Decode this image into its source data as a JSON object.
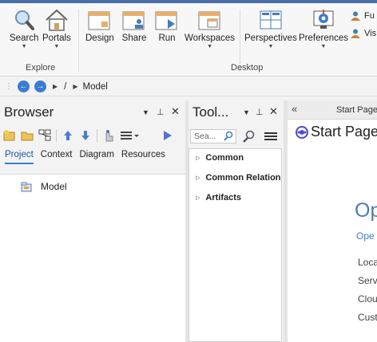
{
  "ribbon": {
    "explore": {
      "label": "Explore",
      "buttons": [
        {
          "name": "search",
          "label": "Search",
          "icon": "magnifier-icon"
        },
        {
          "name": "portals",
          "label": "Portals",
          "icon": "home-icon"
        }
      ]
    },
    "desktop": {
      "label": "Desktop",
      "buttons": [
        {
          "name": "design",
          "label": "Design",
          "icon": "design-window-icon"
        },
        {
          "name": "share",
          "label": "Share",
          "icon": "share-window-icon"
        },
        {
          "name": "run",
          "label": "Run",
          "icon": "run-window-icon"
        },
        {
          "name": "workspaces",
          "label": "Workspaces",
          "icon": "workspace-icon"
        },
        {
          "name": "perspectives",
          "label": "Perspectives",
          "icon": "perspectives-icon"
        },
        {
          "name": "preferences",
          "label": "Preferences",
          "icon": "preferences-icon"
        }
      ]
    },
    "side": [
      {
        "label": "Fu",
        "icon": "user-icon"
      },
      {
        "label": "Vis",
        "icon": "user-icon"
      }
    ]
  },
  "nav": {
    "back": "←",
    "forward": "→",
    "root": "/",
    "current": "Model"
  },
  "browser": {
    "title": "Browser",
    "tabs": [
      "Project",
      "Context",
      "Diagram",
      "Resources"
    ],
    "active_tab": "Project",
    "tree": [
      {
        "label": "Model",
        "icon": "package-icon"
      }
    ]
  },
  "toolbox": {
    "title": "Tool...",
    "search_placeholder": "Sea...",
    "items": [
      "Common",
      "Common Relation",
      "Artifacts"
    ]
  },
  "start_page": {
    "tab_label": "Start Page",
    "heading": "Start Page",
    "big_title": "Op",
    "subtitle": "Ope",
    "links": [
      "Loca",
      "Serv",
      "Clou",
      "Cust"
    ]
  },
  "colors": {
    "accent": "#3a7dd0",
    "title_strip": "#4a6fa8",
    "start_text": "#4a7cb5"
  }
}
